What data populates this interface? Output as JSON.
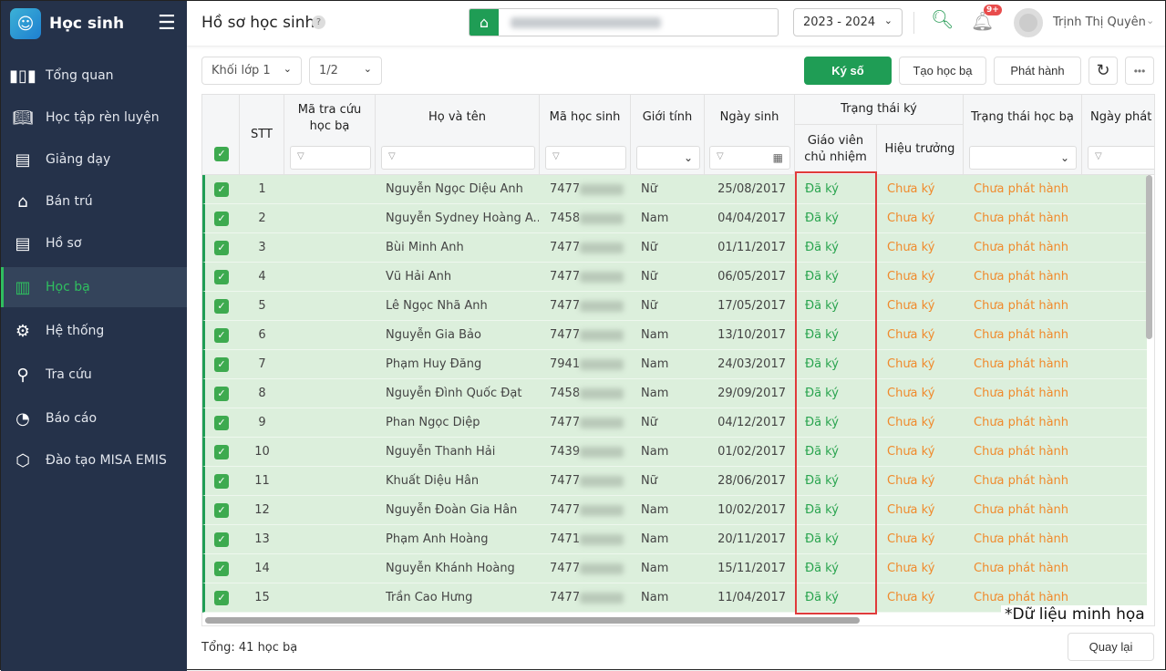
{
  "app": {
    "title": "Học sinh"
  },
  "sidebar": {
    "items": [
      {
        "label": "Tổng quan",
        "icon": "bar-chart-icon"
      },
      {
        "label": "Học tập rèn luyện",
        "icon": "book-icon"
      },
      {
        "label": "Giảng dạy",
        "icon": "board-icon"
      },
      {
        "label": "Bán trú",
        "icon": "home-icon"
      },
      {
        "label": "Hồ sơ",
        "icon": "document-icon"
      },
      {
        "label": "Học bạ",
        "icon": "report-book-icon",
        "active": true
      },
      {
        "label": "Hệ thống",
        "icon": "gear-icon"
      },
      {
        "label": "Tra cứu",
        "icon": "search-icon"
      },
      {
        "label": "Báo cáo",
        "icon": "pie-chart-icon"
      },
      {
        "label": "Đào tạo MISA EMIS",
        "icon": "cube-icon"
      }
    ]
  },
  "header": {
    "title": "Hồ sơ học sinh",
    "help": "?",
    "year": "2023 - 2024",
    "notif_badge": "9+",
    "user": "Trịnh Thị Quyên"
  },
  "toolbar": {
    "grade": "Khối lớp 1",
    "class": "1/2",
    "sign": "Ký số",
    "create": "Tạo học bạ",
    "publish": "Phát hành"
  },
  "table": {
    "headers": {
      "stt": "STT",
      "lookup": "Mã tra cứu học bạ",
      "name": "Họ và tên",
      "code": "Mã học sinh",
      "gender": "Giới tính",
      "dob": "Ngày sinh",
      "sign_status": "Trạng thái ký",
      "teacher": "Giáo viên chủ nhiệm",
      "principal": "Hiệu trưởng",
      "record_status": "Trạng thái học bạ",
      "issue_date": "Ngày phát hành"
    },
    "rows": [
      {
        "stt": "1",
        "name": "Nguyễn Ngọc Diệu Anh",
        "code": "7477",
        "gender": "Nữ",
        "dob": "25/08/2017",
        "teacher": "Đã ký",
        "principal": "Chưa ký",
        "status": "Chưa phát hành"
      },
      {
        "stt": "2",
        "name": "Nguyễn Sydney Hoàng A...",
        "code": "7458",
        "gender": "Nam",
        "dob": "04/04/2017",
        "teacher": "Đã ký",
        "principal": "Chưa ký",
        "status": "Chưa phát hành"
      },
      {
        "stt": "3",
        "name": "Bùi Minh Anh",
        "code": "7477",
        "gender": "Nữ",
        "dob": "01/11/2017",
        "teacher": "Đã ký",
        "principal": "Chưa ký",
        "status": "Chưa phát hành"
      },
      {
        "stt": "4",
        "name": "Vũ Hải Anh",
        "code": "7477",
        "gender": "Nữ",
        "dob": "06/05/2017",
        "teacher": "Đã ký",
        "principal": "Chưa ký",
        "status": "Chưa phát hành"
      },
      {
        "stt": "5",
        "name": "Lê Ngọc Nhã Anh",
        "code": "7477",
        "gender": "Nữ",
        "dob": "17/05/2017",
        "teacher": "Đã ký",
        "principal": "Chưa ký",
        "status": "Chưa phát hành"
      },
      {
        "stt": "6",
        "name": "Nguyễn Gia Bảo",
        "code": "7477",
        "gender": "Nam",
        "dob": "13/10/2017",
        "teacher": "Đã ký",
        "principal": "Chưa ký",
        "status": "Chưa phát hành"
      },
      {
        "stt": "7",
        "name": "Phạm Huy Đăng",
        "code": "7941",
        "gender": "Nam",
        "dob": "24/03/2017",
        "teacher": "Đã ký",
        "principal": "Chưa ký",
        "status": "Chưa phát hành"
      },
      {
        "stt": "8",
        "name": "Nguyễn Đình Quốc Đạt",
        "code": "7458",
        "gender": "Nam",
        "dob": "29/09/2017",
        "teacher": "Đã ký",
        "principal": "Chưa ký",
        "status": "Chưa phát hành"
      },
      {
        "stt": "9",
        "name": "Phan Ngọc Diệp",
        "code": "7477",
        "gender": "Nữ",
        "dob": "04/12/2017",
        "teacher": "Đã ký",
        "principal": "Chưa ký",
        "status": "Chưa phát hành"
      },
      {
        "stt": "10",
        "name": "Nguyễn Thanh Hải",
        "code": "7439",
        "gender": "Nam",
        "dob": "01/02/2017",
        "teacher": "Đã ký",
        "principal": "Chưa ký",
        "status": "Chưa phát hành"
      },
      {
        "stt": "11",
        "name": "Khuất Diệu Hân",
        "code": "7477",
        "gender": "Nữ",
        "dob": "28/06/2017",
        "teacher": "Đã ký",
        "principal": "Chưa ký",
        "status": "Chưa phát hành"
      },
      {
        "stt": "12",
        "name": "Nguyễn Đoàn Gia Hân",
        "code": "7477",
        "gender": "Nam",
        "dob": "10/02/2017",
        "teacher": "Đã ký",
        "principal": "Chưa ký",
        "status": "Chưa phát hành"
      },
      {
        "stt": "13",
        "name": "Phạm Anh Hoàng",
        "code": "7471",
        "gender": "Nam",
        "dob": "20/11/2017",
        "teacher": "Đã ký",
        "principal": "Chưa ký",
        "status": "Chưa phát hành"
      },
      {
        "stt": "14",
        "name": "Nguyễn Khánh Hoàng",
        "code": "7477",
        "gender": "Nam",
        "dob": "15/11/2017",
        "teacher": "Đã ký",
        "principal": "Chưa ký",
        "status": "Chưa phát hành"
      },
      {
        "stt": "15",
        "name": "Trần Cao Hưng",
        "code": "7477",
        "gender": "Nam",
        "dob": "11/04/2017",
        "teacher": "Đã ký",
        "principal": "Chưa ký",
        "status": "Chưa phát hành"
      }
    ]
  },
  "footer": {
    "total": "Tổng: 41 học bạ",
    "back": "Quay lại"
  },
  "note": "*Dữ liệu minh họa",
  "colors": {
    "accent": "#1f9d55",
    "signed": "#2aa44f",
    "unsigned": "#f08a2c",
    "highlight": "#e03b3b",
    "sidebar": "#25324a"
  }
}
